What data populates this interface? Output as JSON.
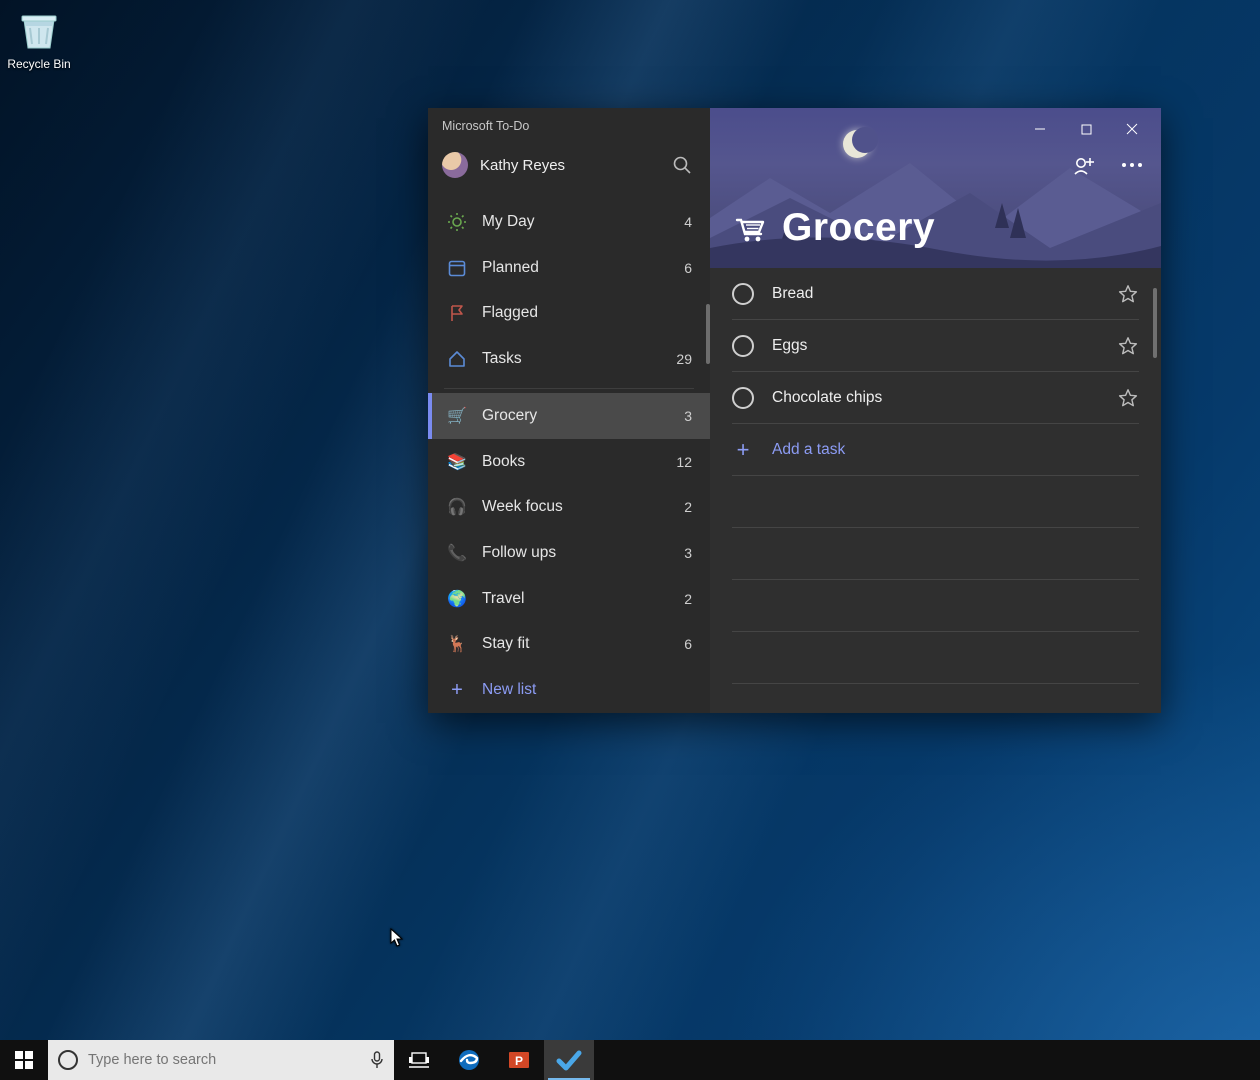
{
  "desktop": {
    "recycle_bin_label": "Recycle Bin",
    "search_placeholder": "Type here to search"
  },
  "app": {
    "title": "Microsoft To-Do",
    "user_name": "Kathy Reyes",
    "new_list_label": "New list",
    "add_task_label": "Add a task"
  },
  "sidebar": [
    {
      "icon": "sun",
      "label": "My Day",
      "count": "4",
      "color": "#6aa84f"
    },
    {
      "icon": "calendar",
      "label": "Planned",
      "count": "6",
      "color": "#5b8bd6"
    },
    {
      "icon": "flag",
      "label": "Flagged",
      "count": "",
      "color": "#c0564b"
    },
    {
      "icon": "home",
      "label": "Tasks",
      "count": "29",
      "color": "#5b8bd6"
    }
  ],
  "user_lists": [
    {
      "emoji": "🛒",
      "label": "Grocery",
      "count": "3",
      "selected": true
    },
    {
      "emoji": "📚",
      "label": "Books",
      "count": "12",
      "selected": false
    },
    {
      "emoji": "🎧",
      "label": "Week focus",
      "count": "2",
      "selected": false
    },
    {
      "emoji": "📞",
      "label": "Follow ups",
      "count": "3",
      "selected": false
    },
    {
      "emoji": "🌍",
      "label": "Travel",
      "count": "2",
      "selected": false
    },
    {
      "emoji": "🦌",
      "label": "Stay fit",
      "count": "6",
      "selected": false
    }
  ],
  "current_list": {
    "title": "Grocery",
    "emoji": "🛒"
  },
  "tasks": [
    {
      "name": "Bread"
    },
    {
      "name": "Eggs"
    },
    {
      "name": "Chocolate chips"
    }
  ]
}
